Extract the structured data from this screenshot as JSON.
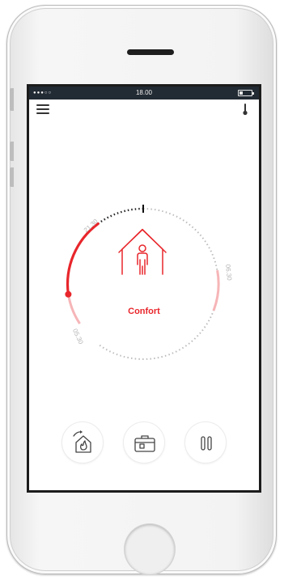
{
  "status_bar": {
    "signal": "●●●○○",
    "time": "18.00",
    "battery_level": 0.25
  },
  "header": {
    "menu_icon": "hamburger-menu-icon",
    "right_icon": "thermometer-icon"
  },
  "dial": {
    "time_labels": [
      "21.30",
      "06.30",
      "05.30"
    ],
    "mode_icon": "house-person-icon",
    "mode_label": "Confort"
  },
  "actions": [
    {
      "name": "home-schedule-button",
      "icon": "house-flame-icon"
    },
    {
      "name": "away-button",
      "icon": "suitcase-icon"
    },
    {
      "name": "pause-button",
      "icon": "pause-icon"
    }
  ],
  "colors": {
    "accent": "#e8262b",
    "accent_light": "#f6b5b7",
    "status_bar": "#222a33"
  }
}
